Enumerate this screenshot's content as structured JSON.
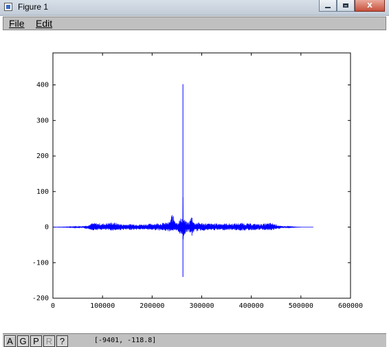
{
  "window": {
    "title": "Figure 1",
    "icon": "figure-window-icon",
    "controls": {
      "minimize": "",
      "maximize": "",
      "close": "X"
    }
  },
  "menu": {
    "items": [
      {
        "label": "File",
        "icon": ""
      },
      {
        "label": "Edit",
        "icon": ""
      }
    ]
  },
  "toolbar": {
    "buttons": [
      {
        "label": "A",
        "state": "active"
      },
      {
        "label": "G",
        "state": "normal"
      },
      {
        "label": "P",
        "state": "normal"
      },
      {
        "label": "R",
        "state": "disabled"
      },
      {
        "label": "?",
        "state": "normal"
      }
    ],
    "cursor_coords": "[-9401, -118.8]"
  },
  "colors": {
    "line": "#0000ff",
    "menubar": "#c0c0c0"
  },
  "chart_data": {
    "type": "line",
    "title": "",
    "xlabel": "",
    "ylabel": "",
    "xlim": [
      0,
      600000
    ],
    "ylim": [
      -200,
      490
    ],
    "xticks": [
      0,
      100000,
      200000,
      300000,
      400000,
      500000,
      600000
    ],
    "xtick_labels": [
      "0",
      "100000",
      "200000",
      "300000",
      "400000",
      "500000",
      "600000"
    ],
    "yticks": [
      -200,
      -100,
      0,
      100,
      200,
      300,
      400
    ],
    "ytick_labels": [
      "-200",
      "-100",
      "0",
      "100",
      "200",
      "300",
      "400"
    ],
    "grid": false,
    "series": [
      {
        "name": "",
        "color": "#0000ff",
        "x": [
          0,
          40000,
          60000,
          72000,
          80000,
          100000,
          120000,
          140000,
          160000,
          180000,
          200000,
          220000,
          235000,
          240000,
          250000,
          255000,
          260000,
          262000,
          262144,
          262300,
          265000,
          270000,
          275000,
          280000,
          285000,
          290000,
          300000,
          320000,
          340000,
          360000,
          380000,
          400000,
          420000,
          440000,
          450000,
          460000,
          480000,
          500000,
          525000
        ],
        "y_max": [
          0,
          1,
          3,
          6,
          12,
          10,
          14,
          8,
          9,
          8,
          10,
          12,
          14,
          38,
          14,
          20,
          30,
          24,
          402,
          28,
          22,
          14,
          16,
          36,
          12,
          14,
          12,
          10,
          11,
          10,
          12,
          10,
          9,
          12,
          8,
          3,
          1,
          0,
          0
        ],
        "y_min": [
          0,
          -1,
          -3,
          -6,
          -9,
          -8,
          -10,
          -8,
          -8,
          -7,
          -8,
          -10,
          -12,
          -10,
          -14,
          -18,
          -28,
          -20,
          -140,
          -40,
          -22,
          -14,
          -12,
          -28,
          -10,
          -12,
          -10,
          -9,
          -9,
          -8,
          -10,
          -9,
          -8,
          -10,
          -7,
          -3,
          -1,
          0,
          0
        ]
      }
    ]
  }
}
